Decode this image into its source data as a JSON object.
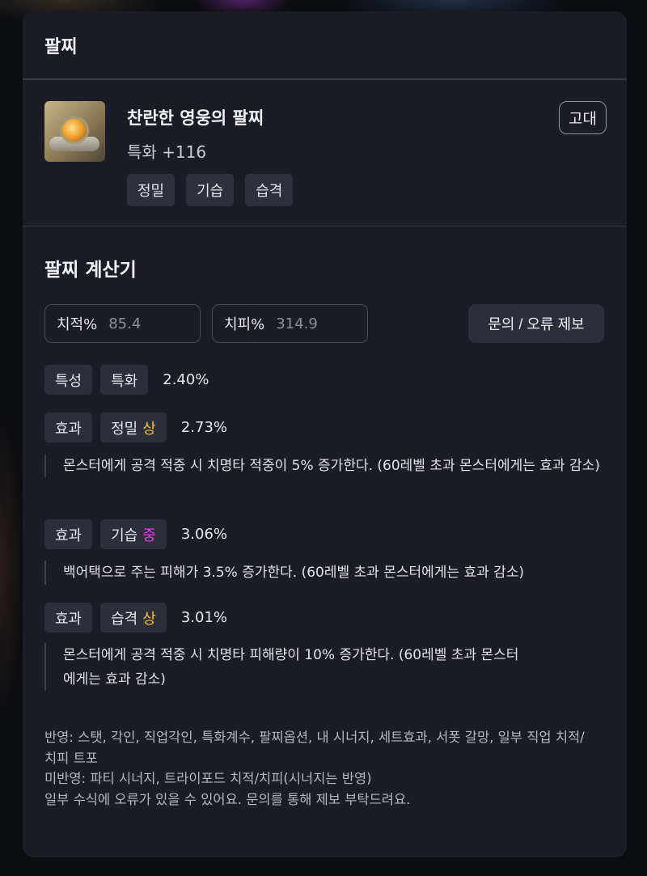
{
  "panel": {
    "title": "팔찌"
  },
  "item": {
    "name": "찬란한 영웅의 팔찌",
    "stat": "특화 +116",
    "grade": "고대",
    "tags": [
      "정밀",
      "기습",
      "습격"
    ],
    "icon": "bracelet-icon"
  },
  "calculator": {
    "title": "팔찌 계산기",
    "crit_rate": {
      "label": "치적%",
      "value": "85.4"
    },
    "crit_damage": {
      "label": "치피%",
      "value": "314.9"
    },
    "report_button": "문의 / 오류 제보",
    "trait_row": {
      "category": "특성",
      "name": "특화",
      "percent": "2.40%"
    },
    "effects": [
      {
        "category": "효과",
        "name": "정밀",
        "grade": "상",
        "percent": "2.73%",
        "description": "몬스터에게 공격 적중 시 치명타 적중이 5% 증가한다. (60레벨 초과 몬스터에게는 효과 감소)"
      },
      {
        "category": "효과",
        "name": "기습",
        "grade": "중",
        "percent": "3.06%",
        "description": "백어택으로 주는 피해가 3.5% 증가한다. (60레벨 초과 몬스터에게는 효과 감소)"
      },
      {
        "category": "효과",
        "name": "습격",
        "grade": "상",
        "percent": "3.01%",
        "description": "몬스터에게 공격 적중 시 치명타 피해량이 10% 증가한다. (60레벨 초과 몬스터에게는 효과 감소)"
      }
    ],
    "notes": [
      "반영: 스탯, 각인, 직업각인, 특화계수, 팔찌옵션, 내 시너지, 세트효과, 서폿 갈망, 일부 직업 치적/치피 트포",
      "미반영: 파티 시너지, 트라이포드 치적/치피(시너지는 반영)",
      "일부 수식에 오류가 있을 수 있어요. 문의를 통해 제보 부탁드려요."
    ]
  },
  "colors": {
    "grade_top": "#f0c435",
    "grade_mid": "#d646e8",
    "panel_bg": "#1c1d24"
  }
}
